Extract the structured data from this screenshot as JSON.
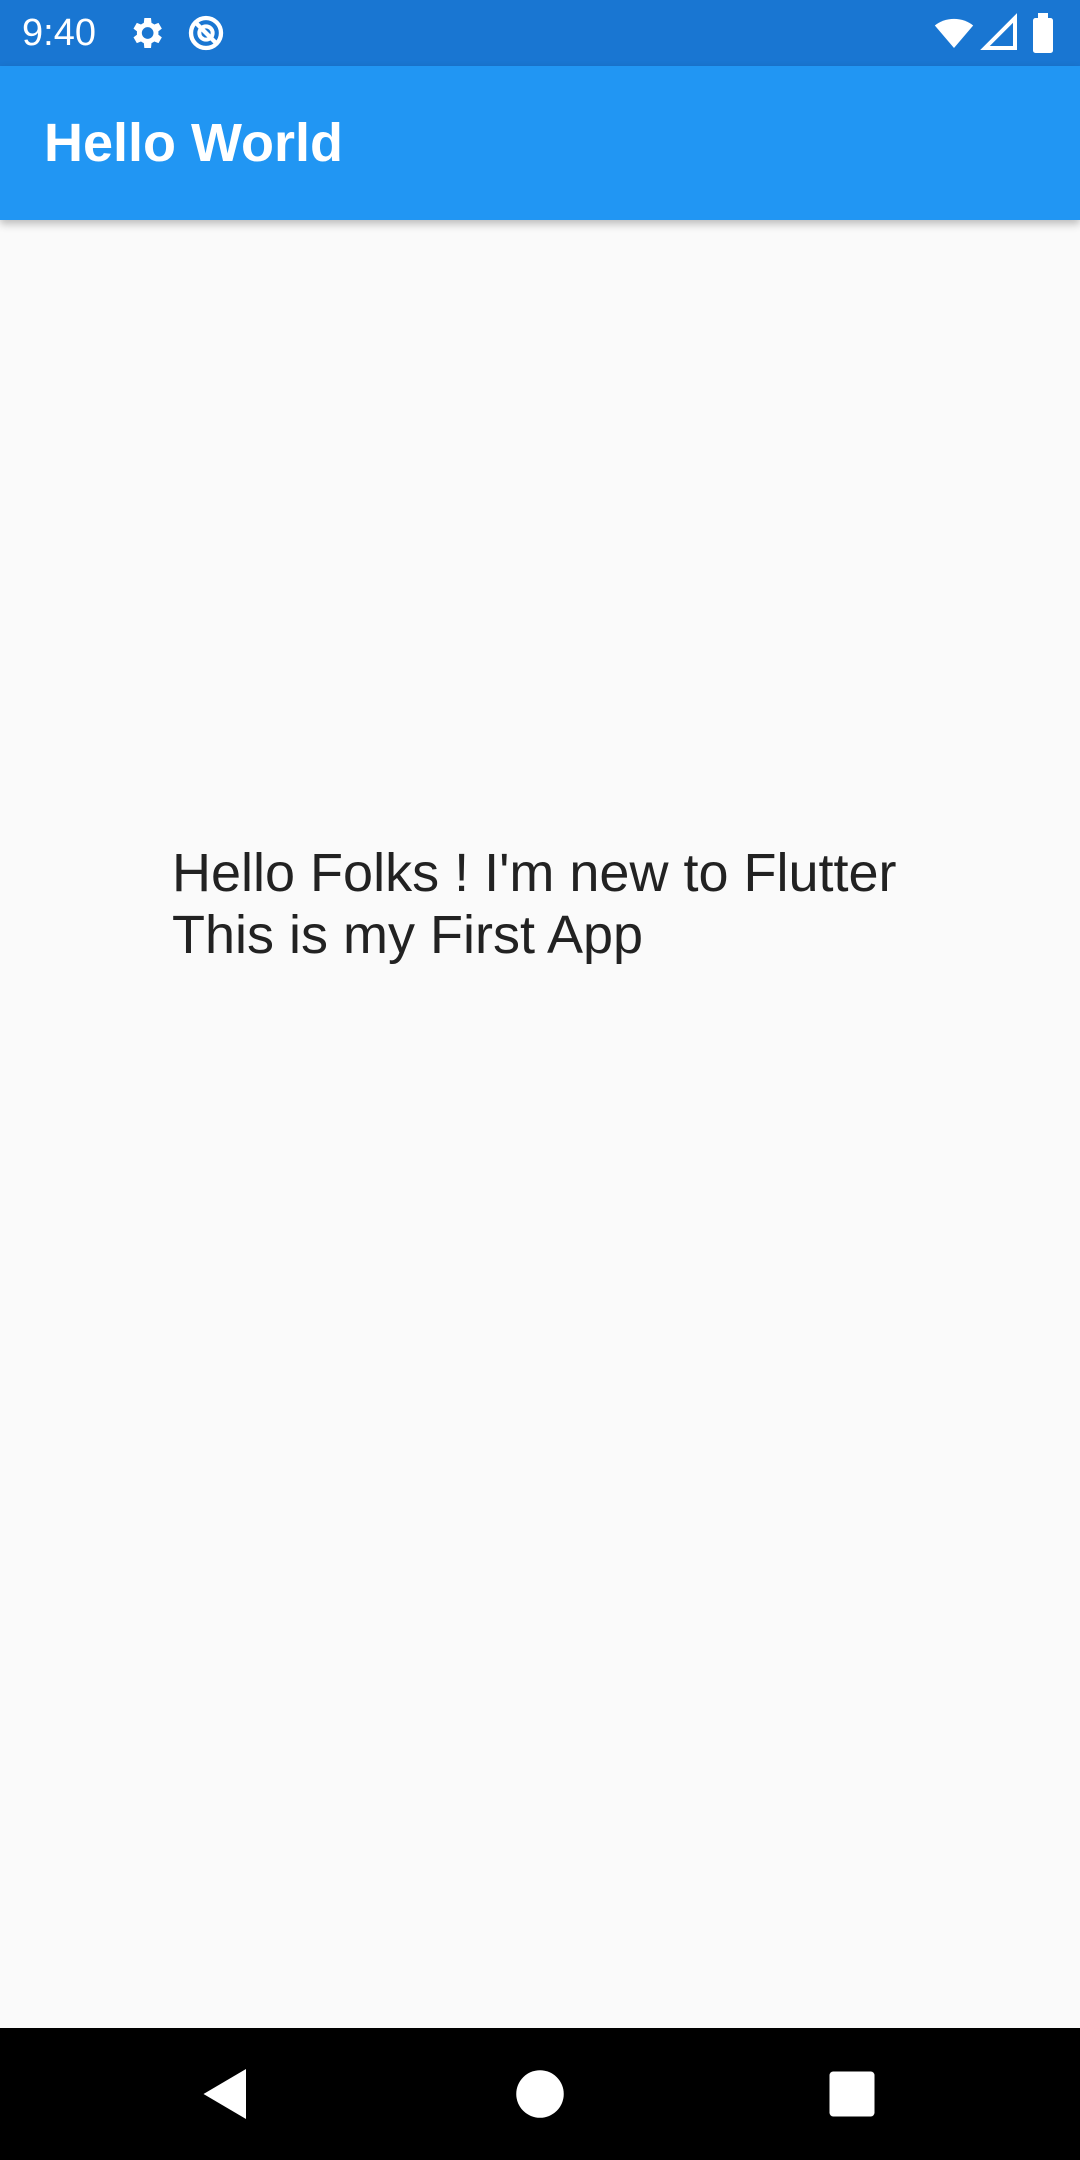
{
  "status_bar": {
    "time": "9:40",
    "icons": [
      "settings-gear-icon",
      "data-saver-icon",
      "wifi-icon",
      "signal-icon",
      "battery-icon"
    ]
  },
  "app_bar": {
    "title": "Hello World",
    "color": "#2196f3"
  },
  "body": {
    "message": "Hello Folks ! I'm new to Flutter\nThis is my First App"
  },
  "nav_bar": {
    "buttons": [
      "back-icon",
      "home-icon",
      "recents-icon"
    ]
  },
  "colors": {
    "status_bar": "#1976d2",
    "app_bar": "#2196f3",
    "background": "#fafafa",
    "nav_bar": "#000000"
  }
}
